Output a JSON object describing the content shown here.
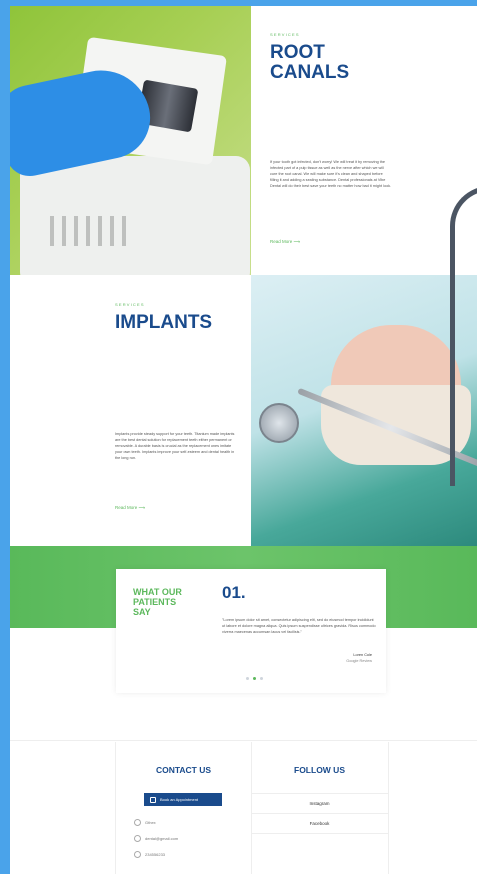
{
  "services": {
    "root_canals": {
      "eyebrow": "Services",
      "title_line1": "ROOT",
      "title_line2": "CANALS",
      "body": "If your tooth got infected, don't worry! We will treat it by removing the infected part of a pulp tissue as well as the nerve after which we will cure the root canal. We will make sure it's clean and shaped before filling it and adding a sealing substance. Dental professionals at Vibe Dental will do their best save your teeth no matter how bad it might look.",
      "read_more": "Read More ⟶"
    },
    "implants": {
      "eyebrow": "Services",
      "title": "IMPLANTS",
      "body": "Implants provide steady support for your teeth. Titanium made implants are the best dental solution for replacement teeth either permanent or removable. A durable basis is crucial as the replacement ones imitate your own teeth. Implants improve your self-esteem and dental health in the long run.",
      "read_more": "Read More ⟶"
    }
  },
  "testimonials": {
    "heading_line1": "WHAT OUR",
    "heading_line2": "PATIENTS",
    "heading_line3": "SAY",
    "number": "01.",
    "quote": "\"Lorem ipsum dolor sit amet, consectetur adipiscing elit, sed do eiusmod tempor incididunt ut labore et dolore magna aliqua. Quis ipsum suspendisse ultrices gravida. Risus commodo viverra maecenas accumsan lacus vel facilisis.\"",
    "author": "Loren Cole",
    "author_role": "Google Review"
  },
  "footer": {
    "contact_title": "CONTACT US",
    "follow_title": "FOLLOW US",
    "book_button": "Book an Appointment",
    "address": "Gthex",
    "email": "dental@gmail.com",
    "phone": "234556233",
    "social": [
      "Instagram",
      "Facebook"
    ]
  },
  "colors": {
    "brand_blue": "#1a4b8c",
    "accent_green": "#5cb85c",
    "frame_blue": "#4aa3ea"
  }
}
